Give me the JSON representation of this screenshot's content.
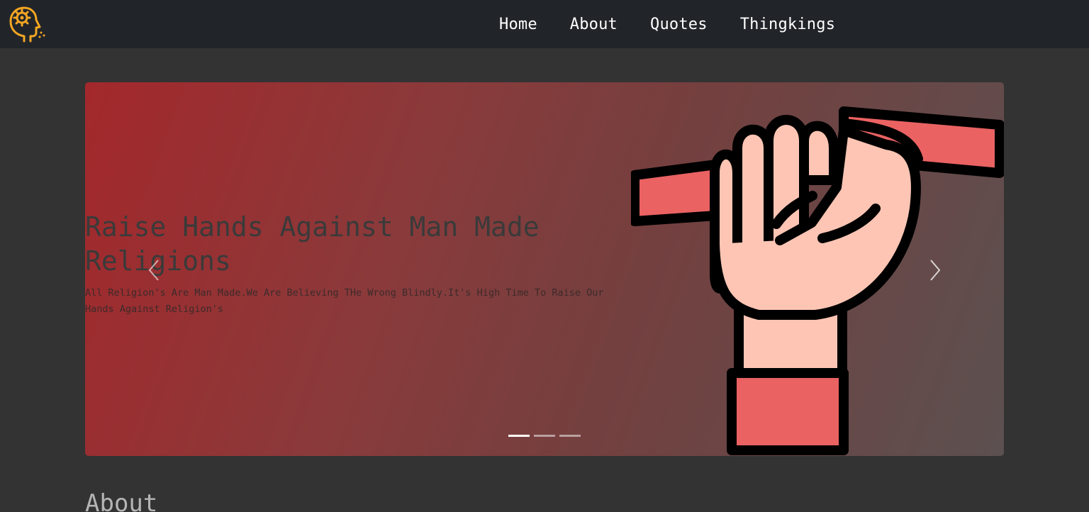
{
  "nav": {
    "logo_icon": "head-gear-icon",
    "links": [
      "Home",
      "About",
      "Quotes",
      "Thingkings"
    ]
  },
  "hero": {
    "title": "Raise Hands Against Man Made Religions",
    "text": "All Religion's Are Man Made.We Are Believing THe Wrong Blindly.It's High Time To Raise Our Hands Against Religion's",
    "image_icon": "raised-fist-icon",
    "prev_icon": "chevron-left-icon",
    "next_icon": "chevron-right-icon",
    "slide_count": 3,
    "active_slide": 1
  },
  "about": {
    "heading": "About"
  },
  "colors": {
    "navbar": "#212529",
    "page": "#333333",
    "accent": "#f5a623"
  }
}
